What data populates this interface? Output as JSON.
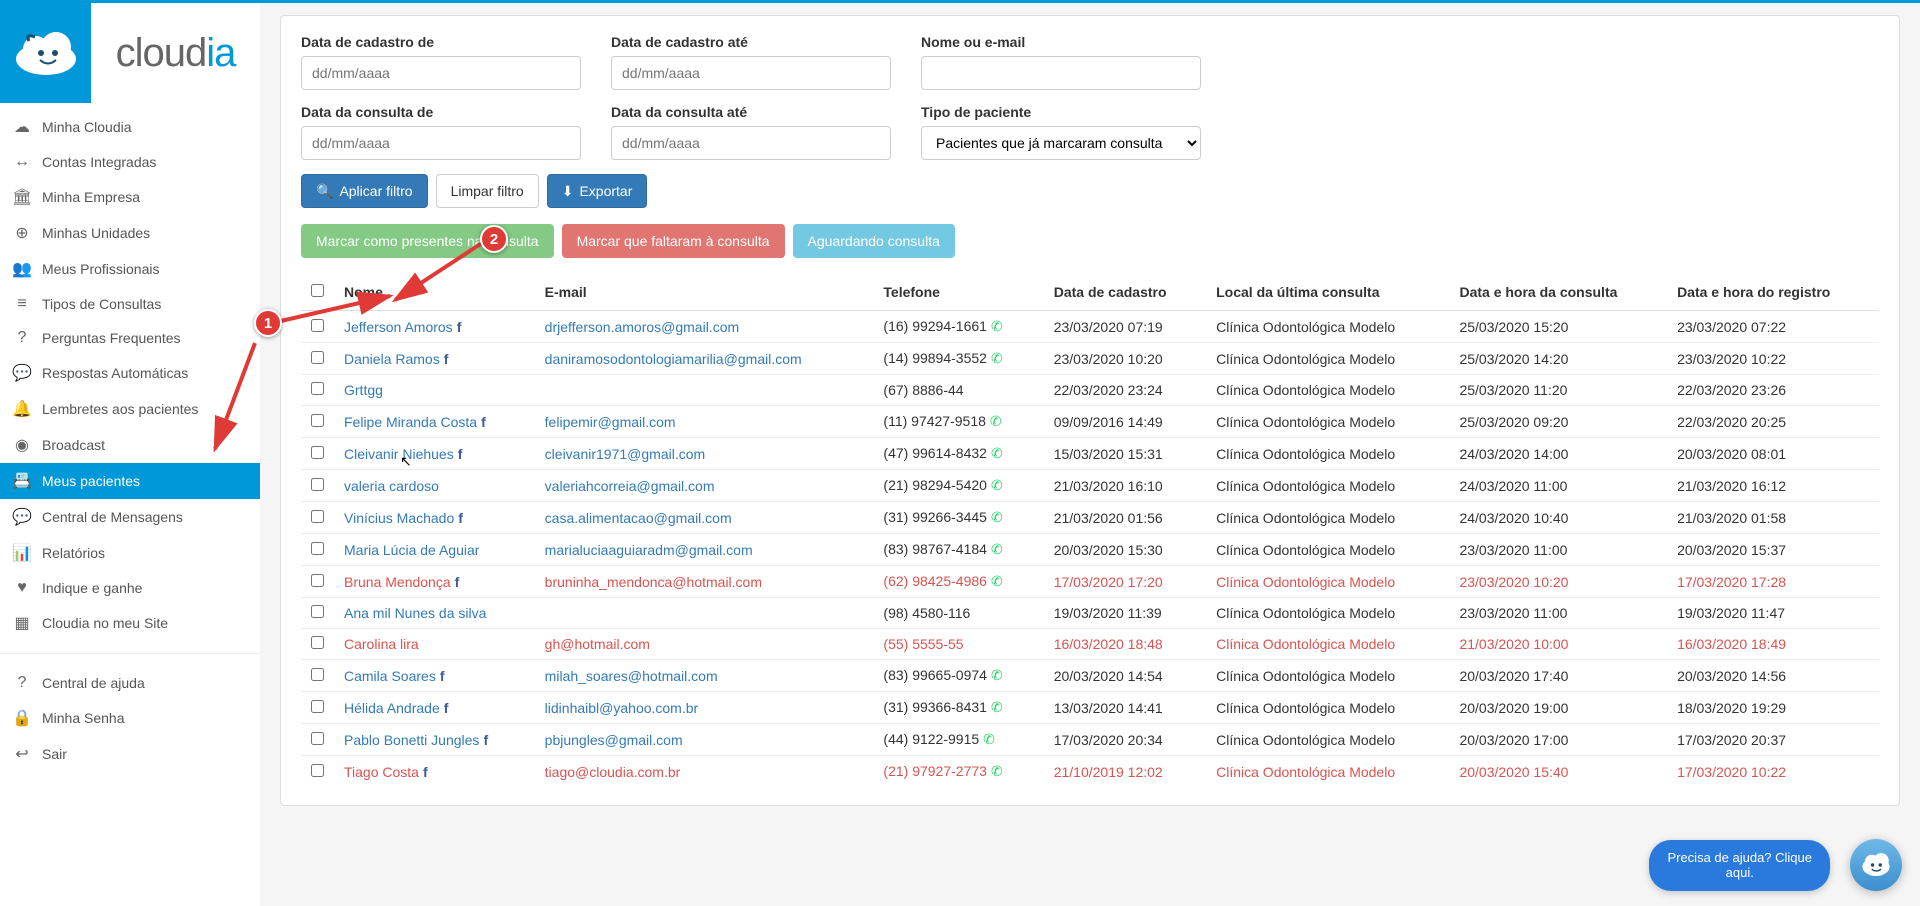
{
  "brand": {
    "name_a": "cloud",
    "name_b": "ia"
  },
  "nav": {
    "items": [
      "Minha Cloudia",
      "Contas Integradas",
      "Minha Empresa",
      "Minhas Unidades",
      "Meus Profissionais",
      "Tipos de Consultas",
      "Perguntas Frequentes",
      "Respostas Automáticas",
      "Lembretes aos pacientes",
      "Broadcast",
      "Meus pacientes",
      "Central de Mensagens",
      "Relatórios",
      "Indique e ganhe",
      "Cloudia no meu Site"
    ],
    "footer": [
      "Central de ajuda",
      "Minha Senha",
      "Sair"
    ],
    "activeIndex": 10
  },
  "filters": {
    "reg_from_label": "Data de cadastro de",
    "reg_to_label": "Data de cadastro até",
    "name_label": "Nome ou e-mail",
    "appt_from_label": "Data da consulta de",
    "appt_to_label": "Data da consulta até",
    "type_label": "Tipo de paciente",
    "date_placeholder": "dd/mm/aaaa",
    "type_selected": "Pacientes que já marcaram consulta",
    "apply": "Aplicar filtro",
    "clear": "Limpar filtro",
    "export": "Exportar"
  },
  "actions": {
    "mark_present": "Marcar como presentes na consulta",
    "mark_absent": "Marcar que faltaram à consulta",
    "awaiting": "Aguardando consulta"
  },
  "table": {
    "headers": [
      "Nome",
      "E-mail",
      "Telefone",
      "Data de cadastro",
      "Local da última consulta",
      "Data e hora da consulta",
      "Data e hora do registro"
    ],
    "rows": [
      {
        "name": "Jefferson Amoros",
        "fb": true,
        "email": "drjefferson.amoros@gmail.com",
        "phone": "(16) 99294-1661",
        "wa": true,
        "reg": "23/03/2020 07:19",
        "loc": "Clínica Odontológica Modelo",
        "appt": "25/03/2020 15:20",
        "created": "23/03/2020 07:22",
        "missed": false
      },
      {
        "name": "Daniela Ramos",
        "fb": true,
        "email": "daniramosodontologiamarilia@gmail.com",
        "phone": "(14) 99894-3552",
        "wa": true,
        "reg": "23/03/2020 10:20",
        "loc": "Clínica Odontológica Modelo",
        "appt": "25/03/2020 14:20",
        "created": "23/03/2020 10:22",
        "missed": false
      },
      {
        "name": "Grttgg",
        "fb": false,
        "email": "",
        "phone": "(67) 8886-44",
        "wa": false,
        "reg": "22/03/2020 23:24",
        "loc": "Clínica Odontológica Modelo",
        "appt": "25/03/2020 11:20",
        "created": "22/03/2020 23:26",
        "missed": false
      },
      {
        "name": "Felipe Miranda Costa",
        "fb": true,
        "email": "felipemir@gmail.com",
        "phone": "(11) 97427-9518",
        "wa": true,
        "reg": "09/09/2016 14:49",
        "loc": "Clínica Odontológica Modelo",
        "appt": "25/03/2020 09:20",
        "created": "22/03/2020 20:25",
        "missed": false
      },
      {
        "name": "Cleivanir Niehues",
        "fb": true,
        "email": "cleivanir1971@gmail.com",
        "phone": "(47) 99614-8432",
        "wa": true,
        "reg": "15/03/2020 15:31",
        "loc": "Clínica Odontológica Modelo",
        "appt": "24/03/2020 14:00",
        "created": "20/03/2020 08:01",
        "missed": false
      },
      {
        "name": "valeria cardoso",
        "fb": false,
        "email": "valeriahcorreia@gmail.com",
        "phone": "(21) 98294-5420",
        "wa": true,
        "reg": "21/03/2020 16:10",
        "loc": "Clínica Odontológica Modelo",
        "appt": "24/03/2020 11:00",
        "created": "21/03/2020 16:12",
        "missed": false
      },
      {
        "name": "Vinícius Machado",
        "fb": true,
        "email": "casa.alimentacao@gmail.com",
        "phone": "(31) 99266-3445",
        "wa": true,
        "reg": "21/03/2020 01:56",
        "loc": "Clínica Odontológica Modelo",
        "appt": "24/03/2020 10:40",
        "created": "21/03/2020 01:58",
        "missed": false
      },
      {
        "name": "Maria Lúcia de Aguiar",
        "fb": false,
        "email": "marialuciaaguiaradm@gmail.com",
        "phone": "(83) 98767-4184",
        "wa": true,
        "reg": "20/03/2020 15:30",
        "loc": "Clínica Odontológica Modelo",
        "appt": "23/03/2020 11:00",
        "created": "20/03/2020 15:37",
        "missed": false
      },
      {
        "name": "Bruna Mendonça",
        "fb": true,
        "email": "bruninha_mendonca@hotmail.com",
        "phone": "(62) 98425-4986",
        "wa": true,
        "reg": "17/03/2020 17:20",
        "loc": "Clínica Odontológica Modelo",
        "appt": "23/03/2020 10:20",
        "created": "17/03/2020 17:28",
        "missed": true
      },
      {
        "name": "Ana mil Nunes da silva",
        "fb": false,
        "email": "",
        "phone": "(98) 4580-116",
        "wa": false,
        "reg": "19/03/2020 11:39",
        "loc": "Clínica Odontológica Modelo",
        "appt": "23/03/2020 11:00",
        "created": "19/03/2020 11:47",
        "missed": false
      },
      {
        "name": "Carolina lira",
        "fb": false,
        "email": "gh@hotmail.com",
        "phone": "(55) 5555-55",
        "wa": false,
        "reg": "16/03/2020 18:48",
        "loc": "Clínica Odontológica Modelo",
        "appt": "21/03/2020 10:00",
        "created": "16/03/2020 18:49",
        "missed": true
      },
      {
        "name": "Camila Soares",
        "fb": true,
        "email": "milah_soares@hotmail.com",
        "phone": "(83) 99665-0974",
        "wa": true,
        "reg": "20/03/2020 14:54",
        "loc": "Clínica Odontológica Modelo",
        "appt": "20/03/2020 17:40",
        "created": "20/03/2020 14:56",
        "missed": false
      },
      {
        "name": "Hélida Andrade",
        "fb": true,
        "email": "lidinhaibl@yahoo.com.br",
        "phone": "(31) 99366-8431",
        "wa": true,
        "reg": "13/03/2020 14:41",
        "loc": "Clínica Odontológica Modelo",
        "appt": "20/03/2020 19:00",
        "created": "18/03/2020 19:29",
        "missed": false
      },
      {
        "name": "Pablo Bonetti Jungles",
        "fb": true,
        "email": "pbjungles@gmail.com",
        "phone": "(44) 9122-9915",
        "wa": true,
        "reg": "17/03/2020 20:34",
        "loc": "Clínica Odontológica Modelo",
        "appt": "20/03/2020 17:00",
        "created": "17/03/2020 20:37",
        "missed": false
      },
      {
        "name": "Tiago Costa",
        "fb": true,
        "email": "tiago@cloudia.com.br",
        "phone": "(21) 97927-2773",
        "wa": true,
        "reg": "21/10/2019 12:02",
        "loc": "Clínica Odontológica Modelo",
        "appt": "20/03/2020 15:40",
        "created": "17/03/2020 10:22",
        "missed": true
      }
    ]
  },
  "help": {
    "line1": "Precisa de ajuda? Clique",
    "line2": "aqui."
  },
  "annotations": {
    "badge1": "1",
    "badge2": "2"
  },
  "nav_icons": [
    "☁",
    "↔",
    "🏛",
    "⊕",
    "👥",
    "≡",
    "?",
    "💬",
    "🔔",
    "◉",
    "📇",
    "💬",
    "📊",
    "♥",
    "▦"
  ],
  "footer_icons": [
    "?",
    "🔒",
    "↩"
  ]
}
